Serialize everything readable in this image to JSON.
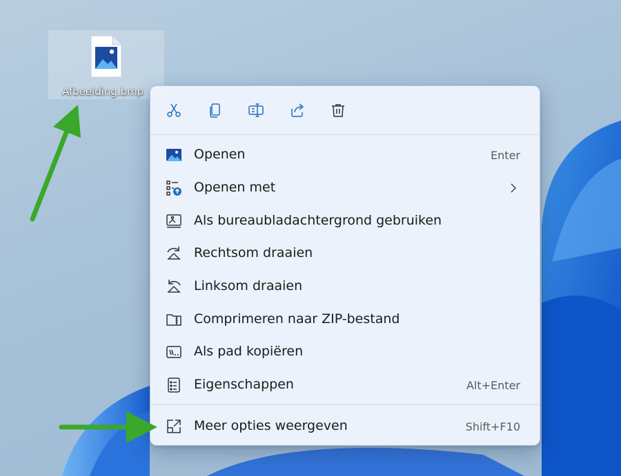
{
  "desktop": {
    "file_name": "Afbeelding.bmp",
    "file_icon": "image-file-icon"
  },
  "quick_actions": [
    {
      "name": "cut",
      "icon": "scissors-icon"
    },
    {
      "name": "copy",
      "icon": "copy-icon"
    },
    {
      "name": "rename",
      "icon": "rename-icon"
    },
    {
      "name": "share",
      "icon": "share-icon"
    },
    {
      "name": "delete",
      "icon": "trash-icon"
    }
  ],
  "menu": {
    "items": [
      {
        "label": "Openen",
        "shortcut": "Enter",
        "icon": "image-icon"
      },
      {
        "label": "Openen met",
        "shortcut": "",
        "icon": "open-with-icon",
        "submenu": true
      },
      {
        "label": "Als bureaubladachtergrond gebruiken",
        "shortcut": "",
        "icon": "wallpaper-icon"
      },
      {
        "label": "Rechtsom draaien",
        "shortcut": "",
        "icon": "rotate-right-icon"
      },
      {
        "label": "Linksom draaien",
        "shortcut": "",
        "icon": "rotate-left-icon"
      },
      {
        "label": "Comprimeren naar ZIP-bestand",
        "shortcut": "",
        "icon": "zip-icon"
      },
      {
        "label": "Als pad kopiëren",
        "shortcut": "",
        "icon": "copy-path-icon"
      },
      {
        "label": "Eigenschappen",
        "shortcut": "Alt+Enter",
        "icon": "properties-icon"
      }
    ],
    "more_options": {
      "label": "Meer opties weergeven",
      "shortcut": "Shift+F10",
      "icon": "more-options-icon"
    }
  },
  "colors": {
    "accent": "#1f6fbf",
    "arrow": "#3aa82a",
    "menu_bg": "#eef4fc"
  }
}
